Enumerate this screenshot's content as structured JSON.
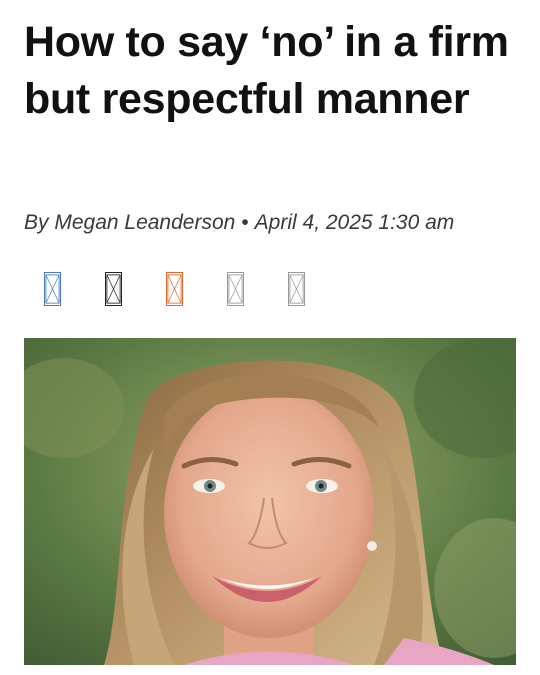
{
  "article": {
    "title": "How to say ‘no’ in a firm but respectful manner",
    "author": "By Megan Leanderson",
    "separator": "•",
    "date": "April 4, 2025 1:30 am"
  },
  "share_buttons": [
    {
      "name": "facebook-share-icon",
      "color": "#4a7cc0"
    },
    {
      "name": "x-share-icon",
      "color": "#222222"
    },
    {
      "name": "reddit-share-icon",
      "color": "#e06a2c"
    },
    {
      "name": "email-share-icon",
      "color": "#9a9a9a"
    },
    {
      "name": "print-share-icon",
      "color": "#9a9a9a"
    }
  ],
  "photo": {
    "description_icon": "author-portrait-image"
  }
}
